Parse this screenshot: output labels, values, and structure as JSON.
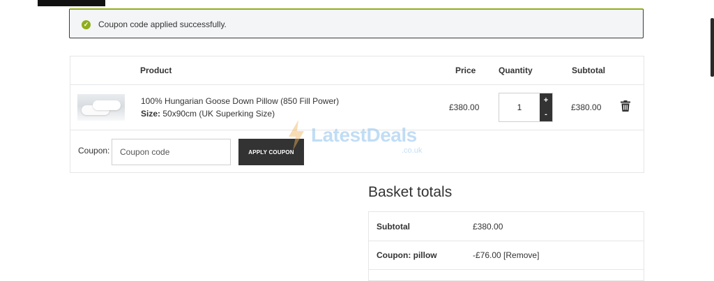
{
  "notice": {
    "message": "Coupon code applied successfully.",
    "icon": "check-circle-icon",
    "accent": "#8fae1b"
  },
  "cart": {
    "headers": {
      "product": "Product",
      "price": "Price",
      "quantity": "Quantity",
      "subtotal": "Subtotal"
    },
    "item": {
      "name": "100% Hungarian Goose Down Pillow (850 Fill Power)",
      "size_label": "Size:",
      "size_value": "50x90cm (UK Superking Size)",
      "price": "£380.00",
      "quantity": "1",
      "subtotal": "£380.00",
      "increment_label": "+",
      "decrement_label": "-"
    },
    "coupon": {
      "label": "Coupon:",
      "placeholder": "Coupon code",
      "button_label": "APPLY COUPON"
    }
  },
  "watermark": {
    "text": "LatestDeals",
    "sub": ".co.uk"
  },
  "totals": {
    "title": "Basket totals",
    "rows": [
      {
        "label": "Subtotal",
        "value": "£380.00"
      },
      {
        "label": "Coupon: pillow",
        "value": "-£76.00",
        "link": "[Remove]"
      }
    ]
  }
}
